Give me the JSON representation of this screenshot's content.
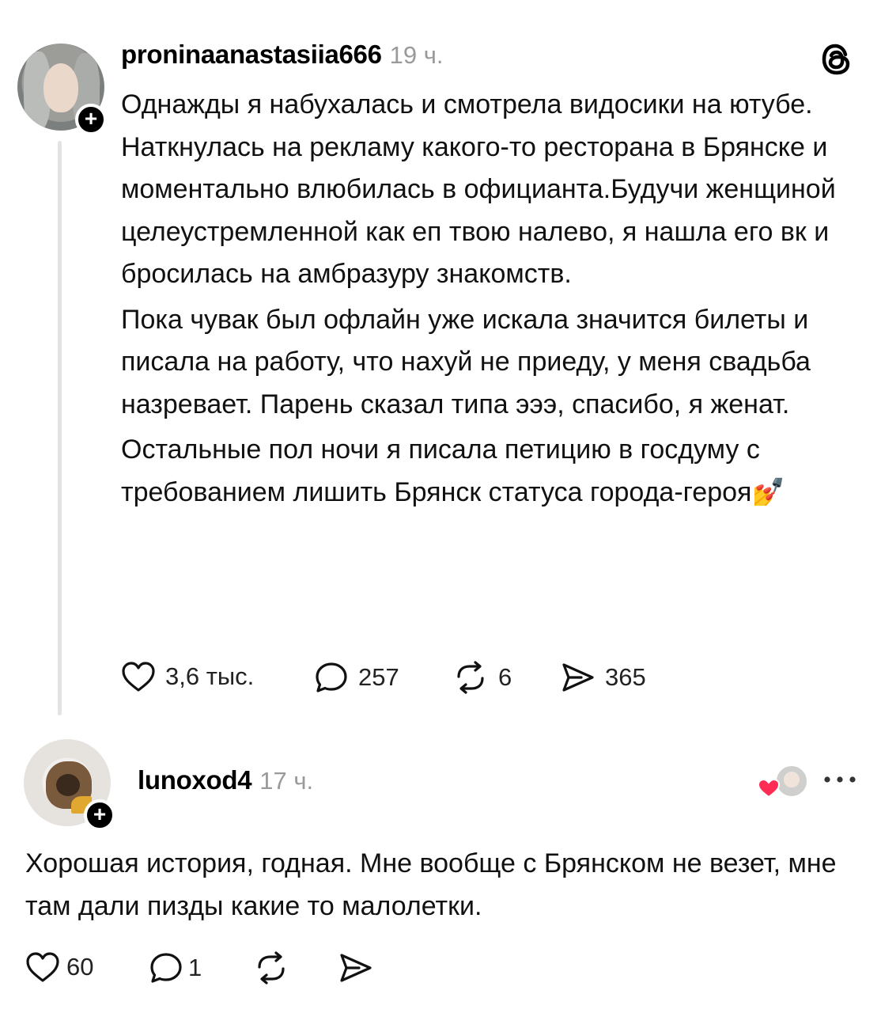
{
  "post": {
    "username": "proninaanastasiia666",
    "time": "19 ч.",
    "paragraphs": [
      "Однажды я набухалась и смотрела видосики на ютубе. Наткнулась на рекламу какого-то ресторана в Брянске и моментально влюбилась в официанта.Будучи женщиной целеустремленной как еп твою налево, я нашла его вк и бросилась на амбразуру знакомств.",
      "Пока чувак был офлайн уже искала значится билеты и писала на работу, что нахуй не приеду, у меня свадьба назревает. Парень сказал типа эээ, спасибо, я женат.",
      "Остальные пол ночи я писала петицию в госдуму с требованием лишить Брянск статуса города-героя"
    ],
    "emoji": "💅",
    "likes": "3,6 тыс.",
    "replies": "257",
    "reposts": "6",
    "shares": "365"
  },
  "reply": {
    "username": "lunoxod4",
    "time": "17 ч.",
    "text": "Хорошая история, годная. Мне вообще с Брянском не везет, мне там дали пизды какие то малолетки.",
    "likes": "60",
    "replies": "1"
  },
  "icons": {
    "app_logo": "threads-logo-icon",
    "follow": "plus-icon",
    "like": "heart-icon",
    "reply": "comment-bubble-icon",
    "repost": "repost-icon",
    "share": "send-icon",
    "more": "more-dots-icon",
    "liked_by_author": "heart-filled-icon"
  },
  "colors": {
    "liked_heart": "#ff2d55",
    "muted_text": "#9a9a9a"
  }
}
